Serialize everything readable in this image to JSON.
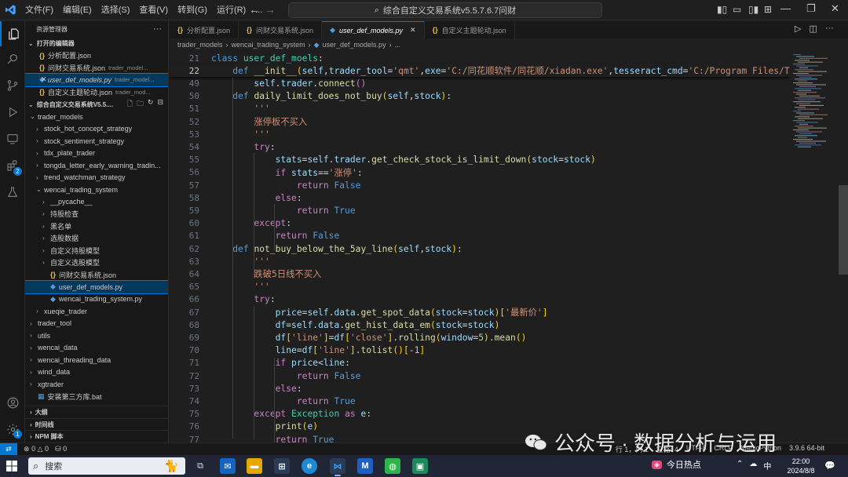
{
  "menu": [
    "文件(F)",
    "编辑(E)",
    "选择(S)",
    "查看(V)",
    "转到(G)",
    "运行(R)",
    "..."
  ],
  "command_center": "综合自定义交易系统v5.5.7.6.7问财",
  "sidebar": {
    "title": "资源管理器",
    "open_editors_title": "打开的编辑器",
    "open_editors": [
      {
        "name": "分析配置.json",
        "desc": "",
        "type": "json"
      },
      {
        "name": "问财交易系统.json",
        "desc": "trader_model...",
        "type": "json"
      },
      {
        "name": "user_def_models.py",
        "desc": "trader_model...",
        "type": "py"
      },
      {
        "name": "自定义主题轮动.json",
        "desc": "trader_mod...",
        "type": "json"
      }
    ],
    "workspace_title": "综合自定义交易系统V5.5....",
    "tree": [
      {
        "label": "trader_models",
        "depth": 1,
        "chev": "v",
        "type": "folder"
      },
      {
        "label": "stock_hot_concept_strategy",
        "depth": 2,
        "chev": ">",
        "type": "folder"
      },
      {
        "label": "stock_sentiment_strategy",
        "depth": 2,
        "chev": ">",
        "type": "folder"
      },
      {
        "label": "tdx_plate_trader",
        "depth": 2,
        "chev": ">",
        "type": "folder"
      },
      {
        "label": "tongda_letter_early_warning_tradin...",
        "depth": 2,
        "chev": ">",
        "type": "folder"
      },
      {
        "label": "trend_watchman_strategy",
        "depth": 2,
        "chev": ">",
        "type": "folder"
      },
      {
        "label": "wencai_trading_system",
        "depth": 2,
        "chev": "v",
        "type": "folder"
      },
      {
        "label": "__pycache__",
        "depth": 3,
        "chev": ">",
        "type": "folder"
      },
      {
        "label": "持股检查",
        "depth": 3,
        "chev": ">",
        "type": "folder"
      },
      {
        "label": "黑名单",
        "depth": 3,
        "chev": ">",
        "type": "folder"
      },
      {
        "label": "选股数据",
        "depth": 3,
        "chev": ">",
        "type": "folder"
      },
      {
        "label": "自定义持股模型",
        "depth": 3,
        "chev": ">",
        "type": "folder"
      },
      {
        "label": "自定义选股模型",
        "depth": 3,
        "chev": ">",
        "type": "folder"
      },
      {
        "label": "问财交易系统.json",
        "depth": 3,
        "chev": "",
        "type": "json"
      },
      {
        "label": "user_def_models.py",
        "depth": 3,
        "chev": "",
        "type": "py",
        "selected": true
      },
      {
        "label": "wencai_trading_system.py",
        "depth": 3,
        "chev": "",
        "type": "py"
      },
      {
        "label": "xueqie_trader",
        "depth": 2,
        "chev": ">",
        "type": "folder"
      },
      {
        "label": "trader_tool",
        "depth": 1,
        "chev": ">",
        "type": "folder"
      },
      {
        "label": "utils",
        "depth": 1,
        "chev": ">",
        "type": "folder"
      },
      {
        "label": "wencai_data",
        "depth": 1,
        "chev": ">",
        "type": "folder"
      },
      {
        "label": "wencai_threading_data",
        "depth": 1,
        "chev": ">",
        "type": "folder"
      },
      {
        "label": "wind_data",
        "depth": 1,
        "chev": ">",
        "type": "folder"
      },
      {
        "label": "xgtrader",
        "depth": 1,
        "chev": ">",
        "type": "folder"
      },
      {
        "label": "安装第三方库.bat",
        "depth": 1,
        "chev": "",
        "type": "bat"
      }
    ],
    "bottom_sections": [
      "大纲",
      "时间线",
      "NPM 脚本"
    ]
  },
  "tabs": [
    {
      "label": "分析配置.json",
      "type": "json",
      "active": false
    },
    {
      "label": "问财交易系统.json",
      "type": "json",
      "active": false
    },
    {
      "label": "user_def_models.py",
      "type": "py",
      "active": true
    },
    {
      "label": "自定义主题轮动.json",
      "type": "json",
      "active": false
    }
  ],
  "breadcrumb": [
    "trader_models",
    "wencai_trading_system",
    "user_def_models.py",
    "..."
  ],
  "code_lines": [
    {
      "n": "21",
      "html": "<span class='kw'>class</span> <span class='cls'>user_def_moels</span>:"
    },
    {
      "n": "22",
      "html": "    <span class='kw'>def</span> <span class='fn'>__init__</span><span class='par'>(</span><span class='self'>self</span>,<span class='self'>trader_tool</span>=<span class='str'>'qmt'</span>,<span class='self'>exe</span>=<span class='str'>'C:/同花顺软件/同花顺/xiadan.exe'</span>,<span class='self'>tesseract_cmd</span>=<span class='str'>'C:/Program Files/Tes</span>"
    },
    {
      "n": "49",
      "html": "        <span class='self'>self</span>.<span class='self'>trader</span>.<span class='fn'>connect</span><span class='par2'>()</span>"
    },
    {
      "n": "50",
      "html": "    <span class='kw'>def</span> <span class='fn'>daily_limit_does_not_buy</span><span class='par'>(</span><span class='self'>self</span>,<span class='self'>stock</span><span class='par'>)</span>:"
    },
    {
      "n": "51",
      "html": "        <span class='str'>'''</span>"
    },
    {
      "n": "52",
      "html": "        <span class='str'>涨停板不买入</span>"
    },
    {
      "n": "53",
      "html": "        <span class='str'>'''</span>"
    },
    {
      "n": "54",
      "html": "        <span class='kw2'>try</span>:"
    },
    {
      "n": "55",
      "html": "            <span class='self'>stats</span>=<span class='self'>self</span>.<span class='self'>trader</span>.<span class='fn'>get_check_stock_is_limit_down</span><span class='par'>(</span><span class='self'>stock</span>=<span class='self'>stock</span><span class='par'>)</span>"
    },
    {
      "n": "56",
      "html": "            <span class='kw2'>if</span> <span class='self'>stats</span>==<span class='str'>'涨停'</span>:"
    },
    {
      "n": "57",
      "html": "                <span class='kw2'>return</span> <span class='kw'>False</span>"
    },
    {
      "n": "58",
      "html": "            <span class='kw2'>else</span>:"
    },
    {
      "n": "59",
      "html": "                <span class='kw2'>return</span> <span class='kw'>True</span>"
    },
    {
      "n": "60",
      "html": "        <span class='kw2'>except</span>:"
    },
    {
      "n": "61",
      "html": "            <span class='kw2'>return</span> <span class='kw'>False</span>"
    },
    {
      "n": "62",
      "html": "    <span class='kw'>def</span> <span class='fn'>not_buy_below_the_5ay_line</span><span class='par'>(</span><span class='self'>self</span>,<span class='self'>stock</span><span class='par'>)</span>:"
    },
    {
      "n": "63",
      "html": "        <span class='str'>'''</span>"
    },
    {
      "n": "64",
      "html": "        <span class='str'>跌破5日线不买入</span>"
    },
    {
      "n": "65",
      "html": "        <span class='str'>'''</span>"
    },
    {
      "n": "66",
      "html": "        <span class='kw2'>try</span>:"
    },
    {
      "n": "67",
      "html": "            <span class='self'>price</span>=<span class='self'>self</span>.<span class='self'>data</span>.<span class='fn'>get_spot_data</span><span class='par'>(</span><span class='self'>stock</span>=<span class='self'>stock</span><span class='par'>)</span><span class='par'>[</span><span class='str'>'最新价'</span><span class='par'>]</span>"
    },
    {
      "n": "68",
      "html": "            <span class='self'>df</span>=<span class='self'>self</span>.<span class='self'>data</span>.<span class='fn'>get_hist_data_em</span><span class='par'>(</span><span class='self'>stock</span>=<span class='self'>stock</span><span class='par'>)</span>"
    },
    {
      "n": "69",
      "html": "            <span class='self'>df</span><span class='par'>[</span><span class='str'>'line'</span><span class='par'>]</span>=<span class='self'>df</span><span class='par'>[</span><span class='str'>'close'</span><span class='par'>]</span>.<span class='fn'>rolling</span><span class='par'>(</span><span class='self'>window</span>=<span class='num'>5</span><span class='par'>)</span>.<span class='fn'>mean</span><span class='par'>()</span>"
    },
    {
      "n": "70",
      "html": "            <span class='self'>line</span>=<span class='self'>df</span><span class='par'>[</span><span class='str'>'line'</span><span class='par'>]</span>.<span class='fn'>tolist</span><span class='par'>()</span><span class='par'>[</span>-<span class='num'>1</span><span class='par'>]</span>"
    },
    {
      "n": "71",
      "html": "            <span class='kw2'>if</span> <span class='self'>price</span>&lt;<span class='self'>line</span>:"
    },
    {
      "n": "72",
      "html": "                <span class='kw2'>return</span> <span class='kw'>False</span>"
    },
    {
      "n": "73",
      "html": "            <span class='kw2'>else</span>:"
    },
    {
      "n": "74",
      "html": "                <span class='kw2'>return</span> <span class='kw'>True</span>"
    },
    {
      "n": "75",
      "html": "        <span class='kw2'>except</span> <span class='cls'>Exception</span> <span class='kw2'>as</span> <span class='self'>e</span>:"
    },
    {
      "n": "76",
      "html": "            <span class='fn'>print</span><span class='par'>(</span><span class='self'>e</span><span class='par'>)</span>"
    },
    {
      "n": "77",
      "html": "            <span class='kw2'>return</span> <span class='kw'>True</span>"
    }
  ],
  "statusbar": {
    "errors": "0",
    "warnings": "0",
    "ports": "0",
    "position": "行 1，列 1",
    "spaces": "空格: 4",
    "encoding": "UTF-8",
    "eol": "CRLF",
    "language": "MagicPython",
    "python": "3.9.6 64-bit"
  },
  "watermark": "公众号 · 数据分析与运用",
  "taskbar": {
    "search": "搜索",
    "news": "今日热点",
    "ime": "中",
    "time": "22:00",
    "date": "2024/8/8"
  },
  "colors": {
    "accent": "#0078d4",
    "editor_bg": "#1f1f1f"
  }
}
